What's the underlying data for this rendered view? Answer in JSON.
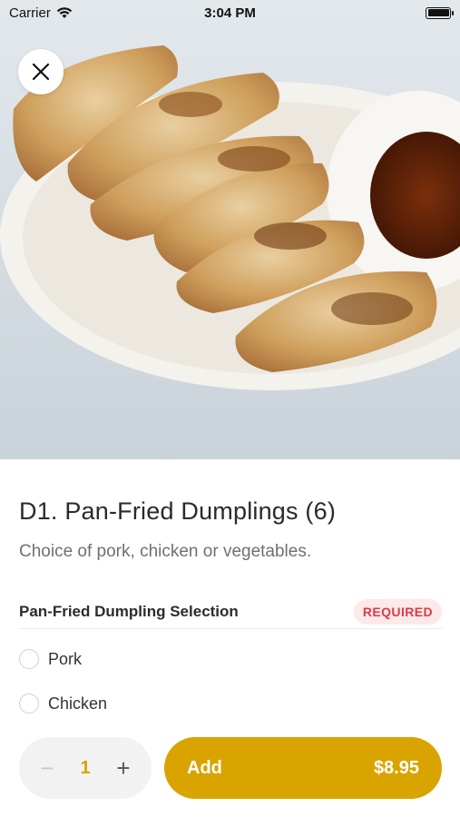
{
  "status_bar": {
    "carrier": "Carrier",
    "time": "3:04 PM"
  },
  "item": {
    "title": "D1. Pan-Fried Dumplings (6)",
    "description": "Choice of pork, chicken or vegetables."
  },
  "selection": {
    "title": "Pan-Fried Dumpling Selection",
    "badge": "REQUIRED",
    "options": [
      {
        "label": "Pork"
      },
      {
        "label": "Chicken"
      }
    ]
  },
  "cart": {
    "quantity": "1",
    "minus": "−",
    "plus": "+",
    "add_label": "Add",
    "price": "$8.95"
  },
  "colors": {
    "accent": "#d9a400",
    "required_bg": "#fde9ea",
    "required_text": "#d93b46"
  },
  "icons": [
    "wifi-icon",
    "battery-icon",
    "close-icon",
    "radio-icon",
    "minus-icon",
    "plus-icon"
  ]
}
